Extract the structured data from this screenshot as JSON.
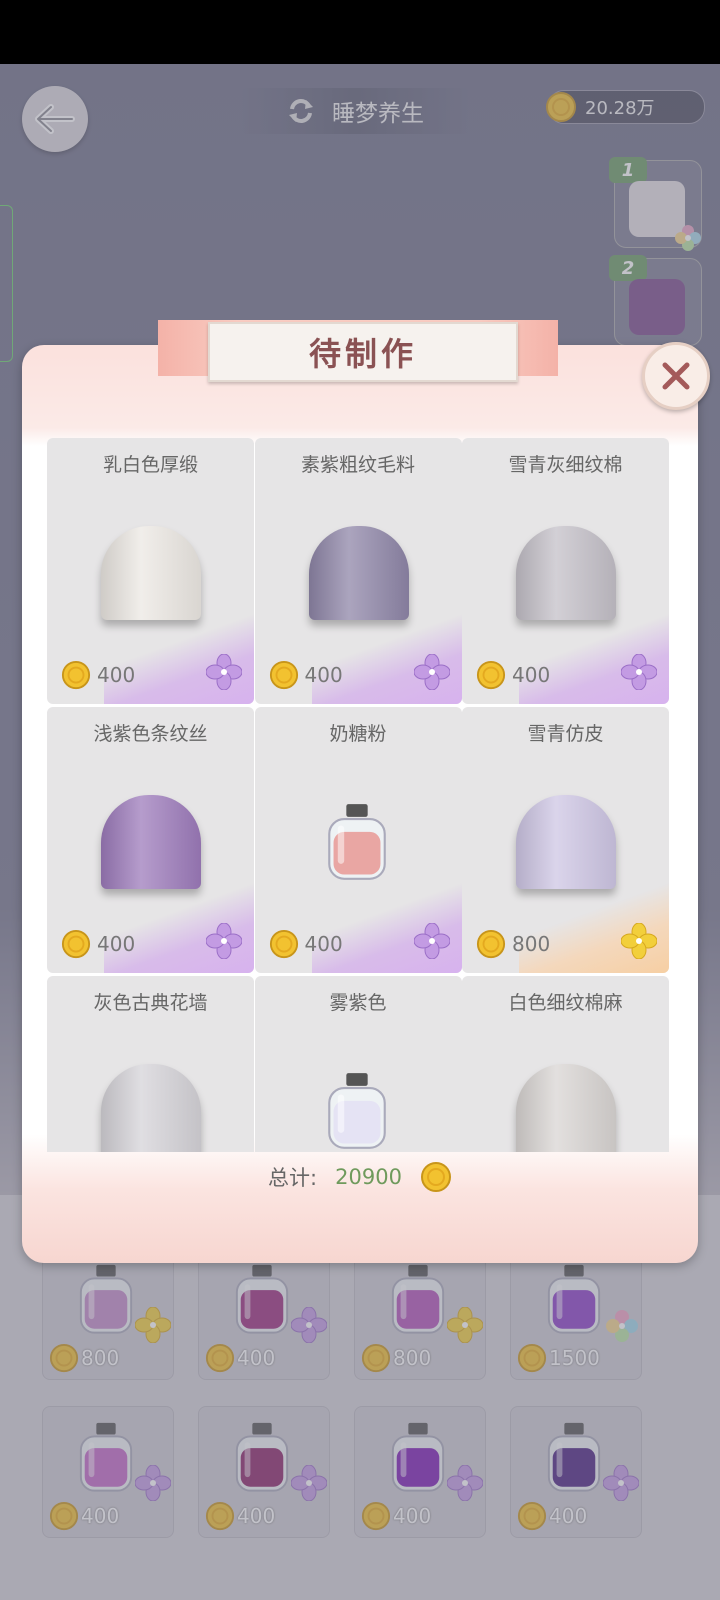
{
  "header": {
    "title": "睡梦养生",
    "coins": "20.28万"
  },
  "side_thumbs": [
    {
      "num": "1"
    },
    {
      "num": "2"
    }
  ],
  "modal": {
    "title": "待制作",
    "total_label": "总计:",
    "total_value": "20900"
  },
  "materials": [
    {
      "name": "乳白色厚缎",
      "price": "400",
      "kind": "fabric",
      "color": "#ece8e3",
      "rarity": "purple"
    },
    {
      "name": "素紫粗纹毛料",
      "price": "400",
      "kind": "fabric",
      "color": "#8f86a8",
      "rarity": "purple"
    },
    {
      "name": "雪青灰细纹棉",
      "price": "400",
      "kind": "fabric",
      "color": "#c4c0c8",
      "rarity": "purple"
    },
    {
      "name": "浅紫色条纹丝",
      "price": "400",
      "kind": "fabric",
      "color": "#9d7bbb",
      "rarity": "purple"
    },
    {
      "name": "奶糖粉",
      "price": "400",
      "kind": "bottle",
      "color": "#e9a6a3",
      "rarity": "purple"
    },
    {
      "name": "雪青仿皮",
      "price": "800",
      "kind": "fabric",
      "color": "#cec6e4",
      "rarity": "gold"
    },
    {
      "name": "灰色古典花墙",
      "price": "",
      "kind": "fabric",
      "color": "#d5d3d8",
      "rarity": ""
    },
    {
      "name": "雾紫色",
      "price": "",
      "kind": "bottle",
      "color": "#e5e3f4",
      "rarity": ""
    },
    {
      "name": "白色细纹棉麻",
      "price": "",
      "kind": "fabric",
      "color": "#d9d5d3",
      "rarity": ""
    }
  ],
  "bottom_items": [
    {
      "price": "800",
      "color": "#c48bc8",
      "rarity": "gold"
    },
    {
      "price": "400",
      "color": "#9b2a7c",
      "rarity": "purple"
    },
    {
      "price": "800",
      "color": "#b350b8",
      "rarity": "gold"
    },
    {
      "price": "1500",
      "color": "#8a3cc6",
      "rarity": "rainbow"
    },
    {
      "price": "400",
      "color": "#c467c7",
      "rarity": "purple"
    },
    {
      "price": "400",
      "color": "#8b2266",
      "rarity": "purple"
    },
    {
      "price": "400",
      "color": "#7d1bb4",
      "rarity": "purple"
    },
    {
      "price": "400",
      "color": "#4a2080",
      "rarity": "purple"
    }
  ],
  "colors": {
    "coin": "#f2c230",
    "accent_title": "#8a5253",
    "total_green": "#6f9a5c"
  },
  "icons": {
    "back": "back-arrow-icon",
    "refresh": "refresh-icon",
    "close": "close-icon",
    "coin": "gold-coin-icon",
    "flower": "flower-icon"
  }
}
